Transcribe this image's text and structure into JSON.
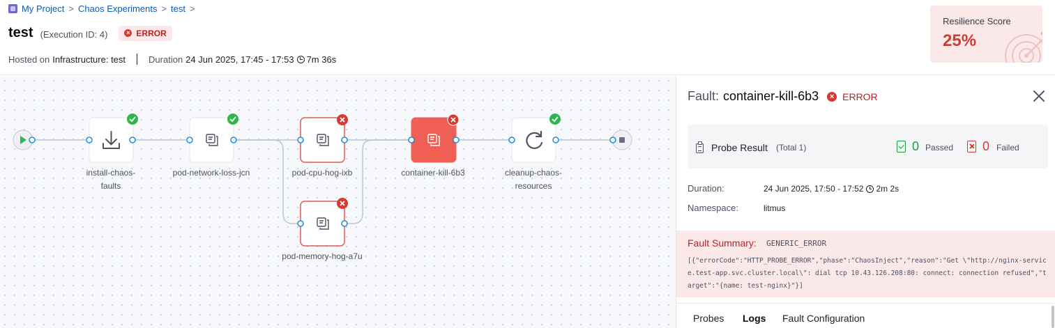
{
  "breadcrumb": {
    "project": "My Project",
    "experiments": "Chaos Experiments",
    "current": "test",
    "separator": ">"
  },
  "header": {
    "title": "test",
    "execution_id": "(Execution ID: 4)",
    "status": "ERROR",
    "hosted_on_label": "Hosted on",
    "infrastructure": "Infrastructure: test",
    "duration_label": "Duration",
    "duration_range": "24 Jun 2025, 17:45 - 17:53",
    "duration_total": "7m 36s"
  },
  "resilience": {
    "label": "Resilience Score",
    "value": "25%"
  },
  "graph": {
    "nodes": [
      {
        "id": "install",
        "label": "install-chaos-faults",
        "status": "success",
        "icon": "download-icon"
      },
      {
        "id": "netloss",
        "label": "pod-network-loss-jcn",
        "status": "success",
        "icon": "fault-icon"
      },
      {
        "id": "cpu",
        "label": "pod-cpu-hog-ixb",
        "status": "error",
        "icon": "fault-icon"
      },
      {
        "id": "mem",
        "label": "pod-memory-hog-a7u",
        "status": "error",
        "icon": "fault-icon"
      },
      {
        "id": "kill",
        "label": "container-kill-6b3",
        "status": "error-selected",
        "icon": "fault-icon"
      },
      {
        "id": "cleanup",
        "label": "cleanup-chaos-resources",
        "status": "success",
        "icon": "refresh-icon"
      }
    ]
  },
  "panel": {
    "fault_prefix": "Fault:",
    "fault_name": "container-kill-6b3",
    "status": "ERROR",
    "probe": {
      "title": "Probe Result",
      "total": "(Total 1)",
      "passed_count": "0",
      "passed_label": "Passed",
      "failed_count": "0",
      "failed_label": "Failed"
    },
    "duration_label": "Duration:",
    "duration_value": "24 Jun 2025, 17:50 - 17:52",
    "duration_total": "2m 2s",
    "namespace_label": "Namespace:",
    "namespace_value": "litmus",
    "summary_title": "Fault Summary:",
    "summary_code": "GENERIC_ERROR",
    "summary_body": "[{\"errorCode\":\"HTTP_PROBE_ERROR\",\"phase\":\"ChaosInject\",\"reason\":\"Get \\\"http://nginx-service.test-app.svc.cluster.local\\\": dial tcp 10.43.126.208:80: connect: connection refused\",\"target\":\"{name: test-nginx}\"}]",
    "tabs": [
      "Probes",
      "Logs",
      "Fault Configuration"
    ],
    "active_tab": "Logs"
  },
  "colors": {
    "accent": "#0b5bb5",
    "error": "#d63a32",
    "success": "#2db84d",
    "node_border_error": "#e05a52",
    "selected_node_fill": "#ef5f55",
    "port": "#1b8fd9"
  }
}
